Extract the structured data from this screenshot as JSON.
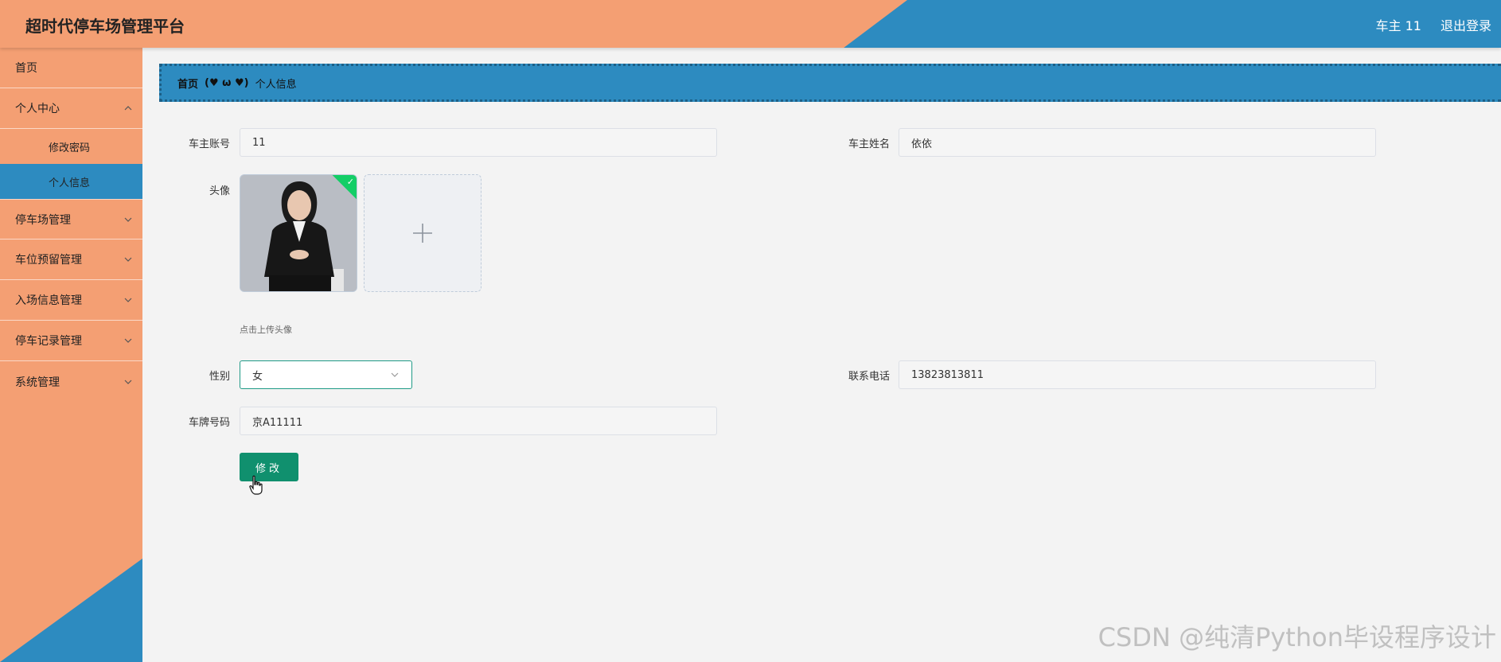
{
  "app": {
    "title": "超时代停车场管理平台"
  },
  "header": {
    "user_label": "车主 11",
    "logout_label": "退出登录"
  },
  "sidebar": {
    "home": "首页",
    "personal_center": "个人中心",
    "change_password": "修改密码",
    "personal_info": "个人信息",
    "parking_lot_mgmt": "停车场管理",
    "space_reservation_mgmt": "车位预留管理",
    "entry_info_mgmt": "入场信息管理",
    "parking_record_mgmt": "停车记录管理",
    "system_mgmt": "系统管理"
  },
  "breadcrumb": {
    "home": "首页",
    "separator": "(♥ ω ♥)",
    "current": "个人信息"
  },
  "form": {
    "account_label": "车主账号",
    "account_value": "11",
    "name_label": "车主姓名",
    "name_value": "依依",
    "avatar_label": "头像",
    "avatar_hint": "点击上传头像",
    "gender_label": "性别",
    "gender_value": "女",
    "phone_label": "联系电话",
    "phone_value": "13823813811",
    "plate_label": "车牌号码",
    "plate_value": "京A11111",
    "submit_label": "修改"
  },
  "watermark": "CSDN @纯清Python毕设程序设计",
  "colors": {
    "orange": "#f49f73",
    "blue": "#2d8bc0",
    "green": "#10906e"
  }
}
